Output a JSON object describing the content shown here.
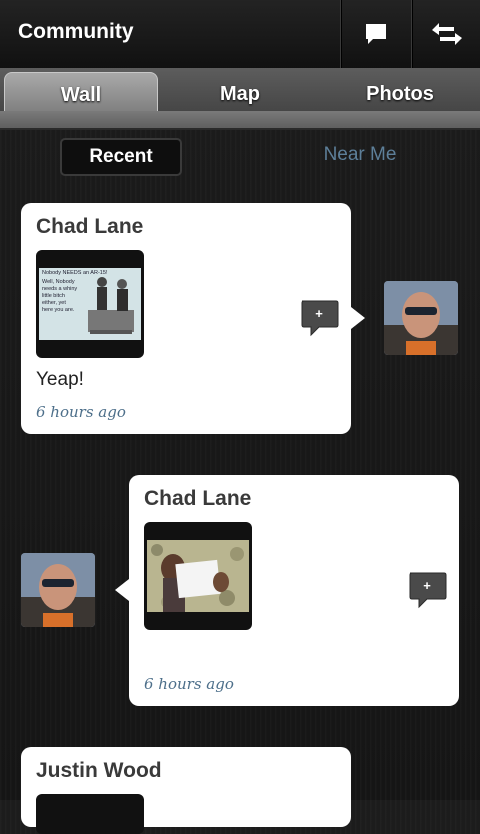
{
  "header": {
    "title": "Community",
    "comment_icon": "comment-icon",
    "refresh_icon": "refresh-icon"
  },
  "tabs": [
    {
      "label": "Wall",
      "active": true
    },
    {
      "label": "Map",
      "active": false
    },
    {
      "label": "Photos",
      "active": false
    }
  ],
  "filters": {
    "recent": "Recent",
    "near_me": "Near Me",
    "selected": "Recent"
  },
  "posts": [
    {
      "author": "Chad Lane",
      "message": "Yeap!",
      "time": "6 hours ago",
      "image_icon": "meme-image",
      "image_lines": [
        "Nobody NEEDS an AR-15!",
        "Well, Nobody",
        "needs a whiny",
        "little bitch",
        "either, yet",
        "here you are."
      ],
      "comment_label": "+"
    },
    {
      "author": "Chad Lane",
      "message": "",
      "time": "6 hours ago",
      "image_icon": "photo-image",
      "comment_label": "+"
    },
    {
      "author": "Justin Wood"
    }
  ],
  "colors": {
    "accent_link": "#4d6f8a",
    "near_me": "#5d7f99"
  }
}
